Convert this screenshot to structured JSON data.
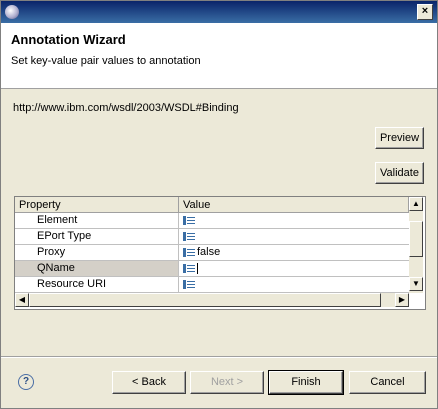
{
  "window": {
    "title_bar": {
      "close_glyph": "×"
    }
  },
  "header": {
    "title": "Annotation Wizard",
    "subtitle": "Set key-value pair values to annotation"
  },
  "namespace_url": "http://www.ibm.com/wsdl/2003/WSDL#Binding",
  "buttons": {
    "preview": "Preview",
    "validate": "Validate",
    "back": "< Back",
    "next": "Next >",
    "finish": "Finish",
    "cancel": "Cancel"
  },
  "table": {
    "columns": [
      "Property",
      "Value"
    ],
    "rows": [
      {
        "property": "Element",
        "value": ""
      },
      {
        "property": "EPort Type",
        "value": ""
      },
      {
        "property": "Proxy",
        "value": "false"
      },
      {
        "property": "QName",
        "value": ""
      },
      {
        "property": "Resource URI",
        "value": ""
      }
    ],
    "selected_row": 3
  },
  "help_glyph": "?",
  "colors": {
    "title_bar_start": "#0a246a",
    "title_bar_end": "#3a6ea5",
    "dialog_bg": "#ece9d8"
  }
}
